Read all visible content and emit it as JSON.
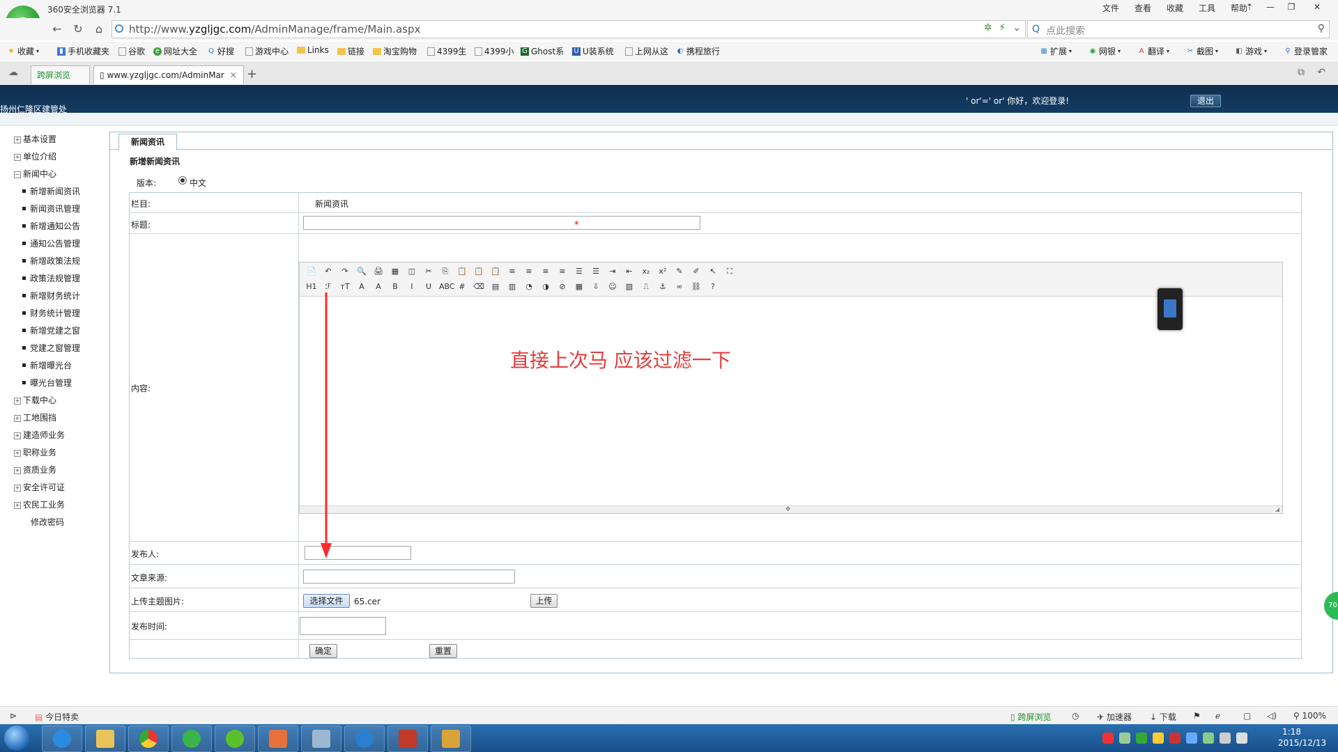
{
  "browser": {
    "title": "360安全浏览器 7.1",
    "menu": [
      "文件",
      "查看",
      "收藏",
      "工具",
      "帮助"
    ],
    "url_prefix": "http://www.",
    "url_domain": "yzgljgc.com",
    "url_path": "/AdminManage/frame/Main.aspx",
    "search_placeholder": "点此搜索",
    "bookmarks": [
      "收藏",
      "手机收藏夹",
      "谷歌",
      "网址大全",
      "好搜",
      "游戏中心",
      "Links",
      "链接",
      "淘宝购物",
      "4399生",
      "4399小",
      "Ghost系",
      "U装系统",
      "上网从这",
      "携程旅行"
    ],
    "bookmarks_right": [
      "扩展",
      "网银",
      "翻译",
      "截图",
      "游戏",
      "登录管家"
    ],
    "tabs": {
      "split": "跨屏浏览",
      "main": "www.yzgljgc.com/AdminMar"
    }
  },
  "header": {
    "site_name": "扬州仁隆区建管处",
    "greeting": "' or'=' or'  你好，欢迎登录!",
    "logout": "退出"
  },
  "sidebar": {
    "groups": [
      {
        "label": "基本设置",
        "sign": "+"
      },
      {
        "label": "单位介绍",
        "sign": "+"
      },
      {
        "label": "新闻中心",
        "sign": "−"
      }
    ],
    "news_children": [
      "新增新闻资讯",
      "新闻资讯管理",
      "新增通知公告",
      "通知公告管理",
      "新增政策法规",
      "政策法规管理",
      "新增财务统计",
      "财务统计管理",
      "新增党建之窗",
      "党建之窗管理",
      "新增曝光台",
      "曝光台管理"
    ],
    "more_groups": [
      "下载中心",
      "工地围挡",
      "建造师业务",
      "职称业务",
      "资质业务",
      "安全许可证",
      "农民工业务"
    ],
    "change_password": "修改密码"
  },
  "panel": {
    "tab": "新闻资讯",
    "form_title": "新增新闻资讯",
    "version_label": "版本:",
    "version_value": "中文",
    "labels": {
      "column": "栏目:",
      "title": "标题:",
      "content": "内容:",
      "publisher": "发布人:",
      "source": "文章来源:",
      "upload": "上传主题图片:",
      "pubtime": "发布时间:"
    },
    "column_value": "新闻资讯",
    "required_mark": "*",
    "choose_file": "选择文件",
    "file_name": "65.cer",
    "upload_btn": "上传",
    "confirm_btn": "确定",
    "reset_btn": "重置"
  },
  "editor": {
    "row1": [
      "📄",
      "↶",
      "↷",
      "🔍",
      "🖨",
      "▦",
      "◫",
      "✂",
      "⎘",
      "📋",
      "📋",
      "📋",
      "≡",
      "≡",
      "≡",
      "≡",
      "☰",
      "☰",
      "⇥",
      "⇤",
      "x₂",
      "x²",
      "✎",
      "✐",
      "↖",
      "⛶"
    ],
    "row2": [
      "H1",
      "ℱ",
      "ᴛT",
      "A",
      "A",
      "B",
      "I",
      "U",
      "ABC",
      "#",
      "⌫",
      "▤",
      "▥",
      "◔",
      "◑",
      "⊘",
      "▦",
      "⇩",
      "☺",
      "▧",
      "⎍",
      "⚓",
      "∞",
      "⛓",
      "?"
    ]
  },
  "annotation": "直接上次马 应该过滤一下",
  "statusbar": {
    "today": "今日特卖",
    "split": "跨屏浏览",
    "accel": "加速器",
    "download": "下载",
    "zoom": "100%"
  },
  "taskbar": {
    "time": "1:18",
    "date": "2015/12/13"
  },
  "green_badge": "70"
}
